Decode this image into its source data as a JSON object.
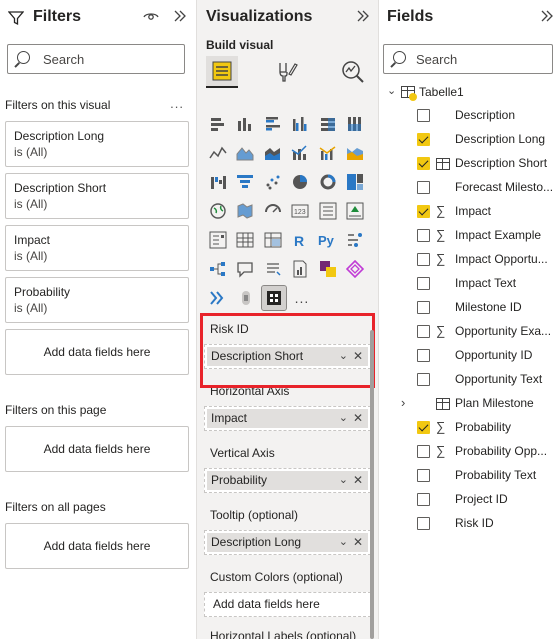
{
  "filters": {
    "title": "Filters",
    "search_placeholder": "Search",
    "on_visual_label": "Filters on this visual",
    "more": "...",
    "cards": [
      {
        "title": "Description Long",
        "state": "is (All)"
      },
      {
        "title": "Description Short",
        "state": "is (All)"
      },
      {
        "title": "Impact",
        "state": "is (All)"
      },
      {
        "title": "Probability",
        "state": "is (All)"
      }
    ],
    "add_label": "Add data fields here",
    "on_page_label": "Filters on this page",
    "on_all_pages_label": "Filters on all pages"
  },
  "visualizations": {
    "title": "Visualizations",
    "build_label": "Build visual",
    "more_visuals": "...",
    "wells": {
      "risk_id": {
        "label": "Risk ID",
        "value": "Description Short"
      },
      "horizontal_axis": {
        "label": "Horizontal Axis",
        "value": "Impact"
      },
      "vertical_axis": {
        "label": "Vertical Axis",
        "value": "Probability"
      },
      "tooltip": {
        "label": "Tooltip (optional)",
        "value": "Description Long"
      },
      "custom_colors": {
        "label": "Custom Colors (optional)",
        "value": "Add data fields here"
      },
      "horizontal_labels": {
        "label": "Horizontal Labels (optional)"
      }
    },
    "highlight_color": "#e8232a"
  },
  "fields": {
    "title": "Fields",
    "search_placeholder": "Search",
    "table_name": "Tabelle1",
    "items": [
      {
        "label": "Description",
        "checked": false,
        "sigma": false
      },
      {
        "label": "Description Long",
        "checked": true,
        "sigma": false
      },
      {
        "label": "Description Short",
        "checked": true,
        "sigma": false,
        "table_icon": true
      },
      {
        "label": "Forecast Milesto...",
        "checked": false,
        "sigma": false
      },
      {
        "label": "Impact",
        "checked": true,
        "sigma": true
      },
      {
        "label": "Impact Example",
        "checked": false,
        "sigma": true
      },
      {
        "label": "Impact Opportu...",
        "checked": false,
        "sigma": true
      },
      {
        "label": "Impact Text",
        "checked": false,
        "sigma": false
      },
      {
        "label": "Milestone ID",
        "checked": false,
        "sigma": false
      },
      {
        "label": "Opportunity Exa...",
        "checked": false,
        "sigma": true
      },
      {
        "label": "Opportunity ID",
        "checked": false,
        "sigma": false
      },
      {
        "label": "Opportunity Text",
        "checked": false,
        "sigma": false
      },
      {
        "label": "Plan Milestone",
        "checked": false,
        "sigma": false,
        "group": true
      },
      {
        "label": "Probability",
        "checked": true,
        "sigma": true
      },
      {
        "label": "Probability Opp...",
        "checked": false,
        "sigma": true
      },
      {
        "label": "Probability Text",
        "checked": false,
        "sigma": false
      },
      {
        "label": "Project ID",
        "checked": false,
        "sigma": false
      },
      {
        "label": "Risk ID",
        "checked": false,
        "sigma": false
      }
    ]
  },
  "colors": {
    "accent_yellow": "#f2c811",
    "pane_gray": "#f3f2f1"
  }
}
